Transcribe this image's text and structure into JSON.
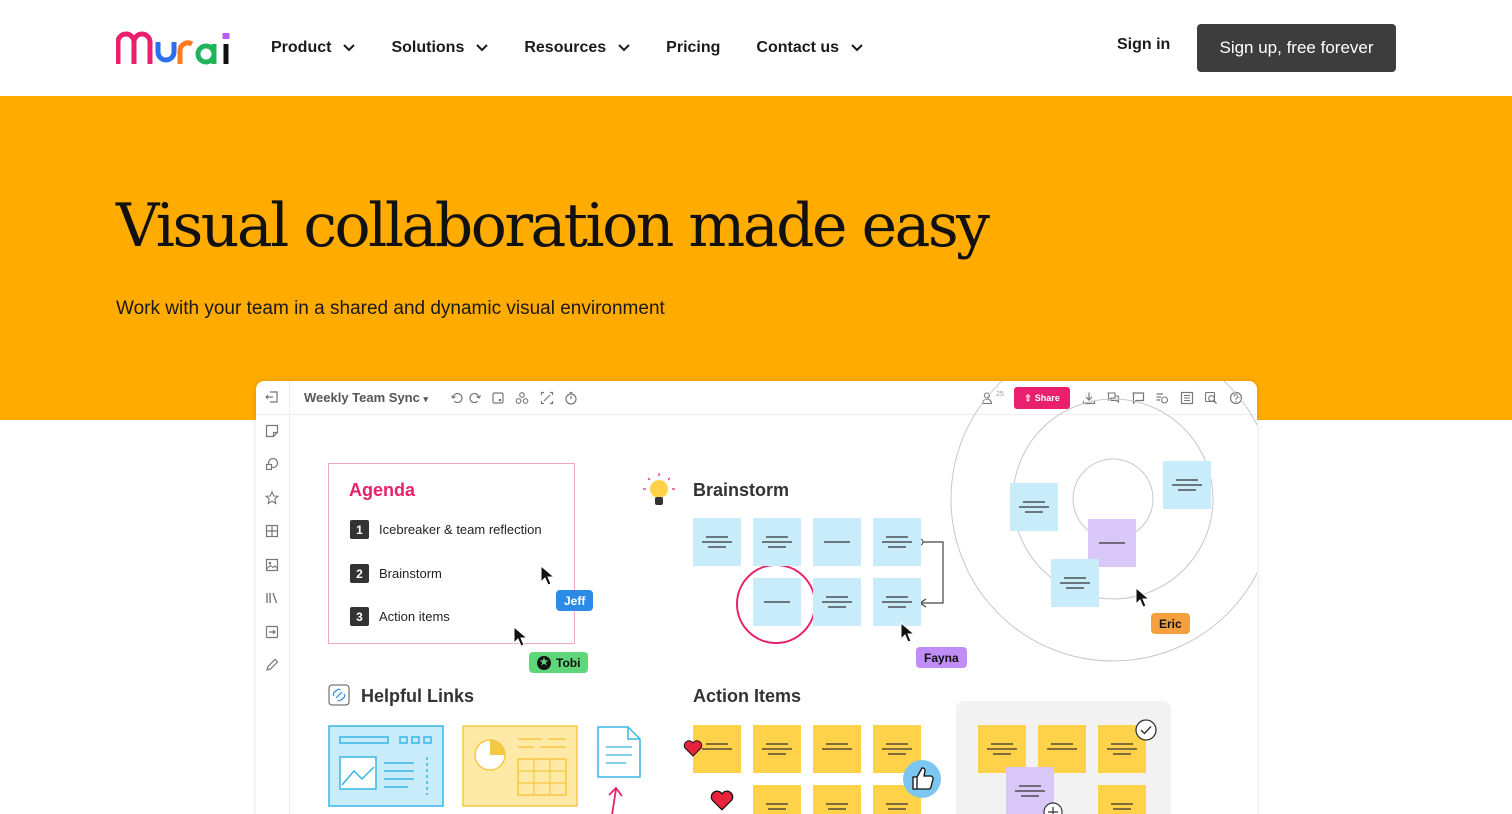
{
  "brand": {
    "logo_text": "mural"
  },
  "nav": {
    "items": [
      {
        "label": "Product",
        "dropdown": true
      },
      {
        "label": "Solutions",
        "dropdown": true
      },
      {
        "label": "Resources",
        "dropdown": true
      },
      {
        "label": "Pricing",
        "dropdown": false
      },
      {
        "label": "Contact us",
        "dropdown": true
      }
    ],
    "sign_in": "Sign in",
    "sign_up": "Sign up, free forever"
  },
  "hero": {
    "title": "Visual collaboration made easy",
    "subtitle": "Work with your team in a shared and dynamic visual environment"
  },
  "board": {
    "title": "Weekly Team Sync",
    "share": "Share",
    "members_count": "25",
    "agenda": {
      "title": "Agenda",
      "items": [
        {
          "num": "1",
          "label": "Icebreaker & team reflection"
        },
        {
          "num": "2",
          "label": "Brainstorm"
        },
        {
          "num": "3",
          "label": "Action items"
        }
      ]
    },
    "brainstorm_title": "Brainstorm",
    "helpful_links_title": "Helpful Links",
    "action_items_title": "Action Items",
    "cursors": {
      "jeff": "Jeff",
      "tobi": "Tobi",
      "fayna": "Fayna",
      "eric": "Eric"
    }
  },
  "colors": {
    "hero_bg": "#ffab00",
    "accent_pink": "#e8206d",
    "sticky_blue": "#c9ecfb",
    "sticky_yellow": "#ffd24a",
    "sticky_purple": "#d9c8f7",
    "tag_jeff": "#2b8be6",
    "tag_tobi": "#5ed67a",
    "tag_fayna": "#c08cf5",
    "tag_eric": "#f5a03c"
  }
}
